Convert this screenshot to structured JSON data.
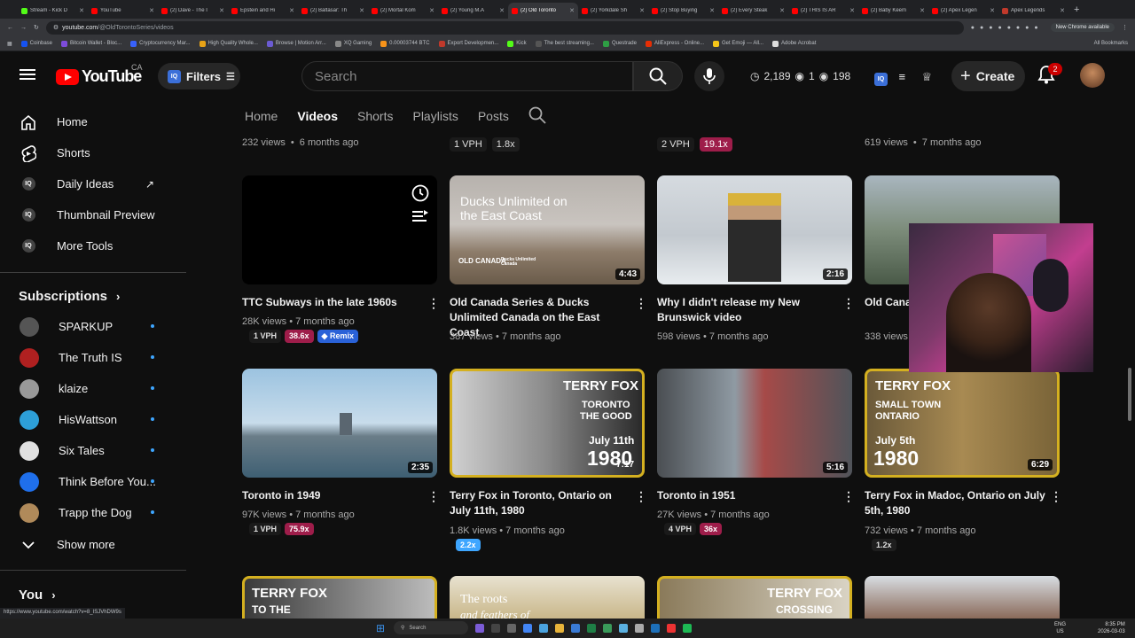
{
  "browser": {
    "tabs": [
      {
        "label": "Stream - Kick D",
        "color": "#53fc18"
      },
      {
        "label": "YouTube",
        "color": "#ff0000"
      },
      {
        "label": "(2) Dave - The I",
        "color": "#ff0000"
      },
      {
        "label": "Epstein and Hi",
        "color": "#ff0000"
      },
      {
        "label": "(2) Baltasar: Th",
        "color": "#ff0000"
      },
      {
        "label": "(2) Mortal Kom",
        "color": "#ff0000"
      },
      {
        "label": "(2) Young M.A",
        "color": "#ff0000"
      },
      {
        "label": "(2) Old Toronto",
        "color": "#ff0000",
        "active": true
      },
      {
        "label": "(2) Yorkdale Sh",
        "color": "#ff0000"
      },
      {
        "label": "(2) Stop Buying",
        "color": "#ff0000"
      },
      {
        "label": "(2) Every Steak",
        "color": "#ff0000"
      },
      {
        "label": "(2) THIS IS AR",
        "color": "#ff0000"
      },
      {
        "label": "(2) Baby Keem",
        "color": "#ff0000"
      },
      {
        "label": "(2) Apex Legen",
        "color": "#ff0000"
      },
      {
        "label": "Apex Legends",
        "color": "#c0392b"
      }
    ],
    "url_host": "youtube.com",
    "url_path": "/@OldTorontoSeries/videos",
    "new_chrome": "New Chrome available",
    "bookmarks": [
      {
        "label": "Coinbase",
        "color": "#1652f0"
      },
      {
        "label": "Bitcoin Wallet - Bloc...",
        "color": "#7d4cdb"
      },
      {
        "label": "Cryptocurrency Mar...",
        "color": "#3861fb"
      },
      {
        "label": "High Quality Whole...",
        "color": "#e8a317"
      },
      {
        "label": "Browse | Motion Arr...",
        "color": "#6b5bd2"
      },
      {
        "label": "XQ Gaming",
        "color": "#888888"
      },
      {
        "label": "0.00003744 BTC",
        "color": "#f7931a"
      },
      {
        "label": "Export Developmen...",
        "color": "#c0392b"
      },
      {
        "label": "Kick",
        "color": "#53fc18"
      },
      {
        "label": "The best streaming...",
        "color": "#555555"
      },
      {
        "label": "Questrade",
        "color": "#2e9e44"
      },
      {
        "label": "AliExpress - Online...",
        "color": "#e62e04"
      },
      {
        "label": "Get Emoji — All...",
        "color": "#f5c518"
      },
      {
        "label": "Adobe Acrobat",
        "color": "#dddddd"
      }
    ],
    "all_bookmarks": "All Bookmarks",
    "status_url": "https://www.youtube.com/watch?v=8_ISJVhDW9s"
  },
  "header": {
    "logo_text": "YouTube",
    "country": "CA",
    "filters_label": "Filters",
    "search_placeholder": "Search",
    "stat1": "2,189",
    "stat2": "1",
    "stat3": "198",
    "create_label": "Create",
    "notif_count": "2"
  },
  "sidebar": {
    "main": [
      {
        "label": "Home"
      },
      {
        "label": "Shorts"
      },
      {
        "label": "Daily Ideas"
      },
      {
        "label": "Thumbnail Preview"
      },
      {
        "label": "More Tools"
      }
    ],
    "subs_heading": "Subscriptions",
    "subs": [
      {
        "label": "SPARKUP",
        "color": "#555555"
      },
      {
        "label": "The Truth IS",
        "color": "#b02020"
      },
      {
        "label": "klaize",
        "color": "#999999"
      },
      {
        "label": "HisWattson",
        "color": "#2d9fd8"
      },
      {
        "label": "Six Tales",
        "color": "#e0e0e0"
      },
      {
        "label": "Think Before You...",
        "color": "#1f6feb"
      },
      {
        "label": "Trapp the Dog",
        "color": "#b08a5a"
      }
    ],
    "show_more": "Show more",
    "you_heading": "You"
  },
  "channel_tabs": [
    "Home",
    "Videos",
    "Shorts",
    "Playlists",
    "Posts"
  ],
  "prev_row": [
    {
      "views": "232 views",
      "age": "6 months ago"
    },
    {
      "vph": "1 VPH",
      "mult": "1.8x"
    },
    {
      "vph": "2 VPH",
      "mult": "19.1x"
    },
    {
      "views": "619 views",
      "age": "7 months ago"
    }
  ],
  "row1": [
    {
      "title": "TTC Subways in the late 1960s",
      "views": "28K views",
      "age": "7 months ago",
      "vph": "1 VPH",
      "mult": "38.6x",
      "remix": "Remix"
    },
    {
      "title": "Old Canada Series & Ducks Unlimited Canada on the East Coast",
      "views": "387 views",
      "age": "7 months ago",
      "duration": "4:43",
      "overlay": "Ducks Unlimited on the East Coast",
      "logo1": "OLD CANADA",
      "logo2": "Ducks Unlimited Canada"
    },
    {
      "title": "Why I didn't release my New Brunswick video",
      "views": "598 views",
      "age": "7 months ago",
      "duration": "2:16"
    },
    {
      "title": "Old Canada Series & Ducks Unlimited...",
      "views": "338 views",
      "age": "7 months ago"
    }
  ],
  "row2": [
    {
      "title": "Toronto in 1949",
      "views": "97K views",
      "age": "7 months ago",
      "vph": "1 VPH",
      "mult": "75.9x",
      "duration": "2:35"
    },
    {
      "title": "Terry Fox in Toronto, Ontario on July 11th, 1980",
      "views": "1.8K views",
      "age": "7 months ago",
      "mult": "2.2x",
      "duration": "7:17",
      "ov1": "TERRY FOX",
      "ov2": "TORONTO",
      "ov3": "THE GOOD",
      "ov4": "July 11th",
      "ov5": "1980"
    },
    {
      "title": "Toronto in 1951",
      "views": "27K views",
      "age": "7 months ago",
      "vph": "4 VPH",
      "mult": "36x",
      "duration": "5:16"
    },
    {
      "title": "Terry Fox in Madoc, Ontario on July 5th, 1980",
      "views": "732 views",
      "age": "7 months ago",
      "mult": "1.2x",
      "duration": "6:29",
      "ov1": "TERRY FOX",
      "ov2": "SMALL TOWN",
      "ov3": "ONTARIO",
      "ov4": "July 5th",
      "ov5": "1980"
    }
  ],
  "row3": [
    {
      "ov1": "TERRY FOX",
      "ov2": "TO THE"
    },
    {
      "ov1": "The roots",
      "ov2": "and feathers of"
    },
    {
      "ov1": "TERRY FOX",
      "ov2": "CROSSING"
    },
    {}
  ],
  "taskbar": {
    "search_label": "Search",
    "lang1": "ENG",
    "lang2": "US",
    "time": "8:35 PM",
    "date": "2026-03-03"
  },
  "colors": {
    "accent_red": "#ff0000",
    "badge_blue": "#3ea6ff",
    "tag_red": "#9e1d4a",
    "tag_blue": "#2a62d8"
  }
}
